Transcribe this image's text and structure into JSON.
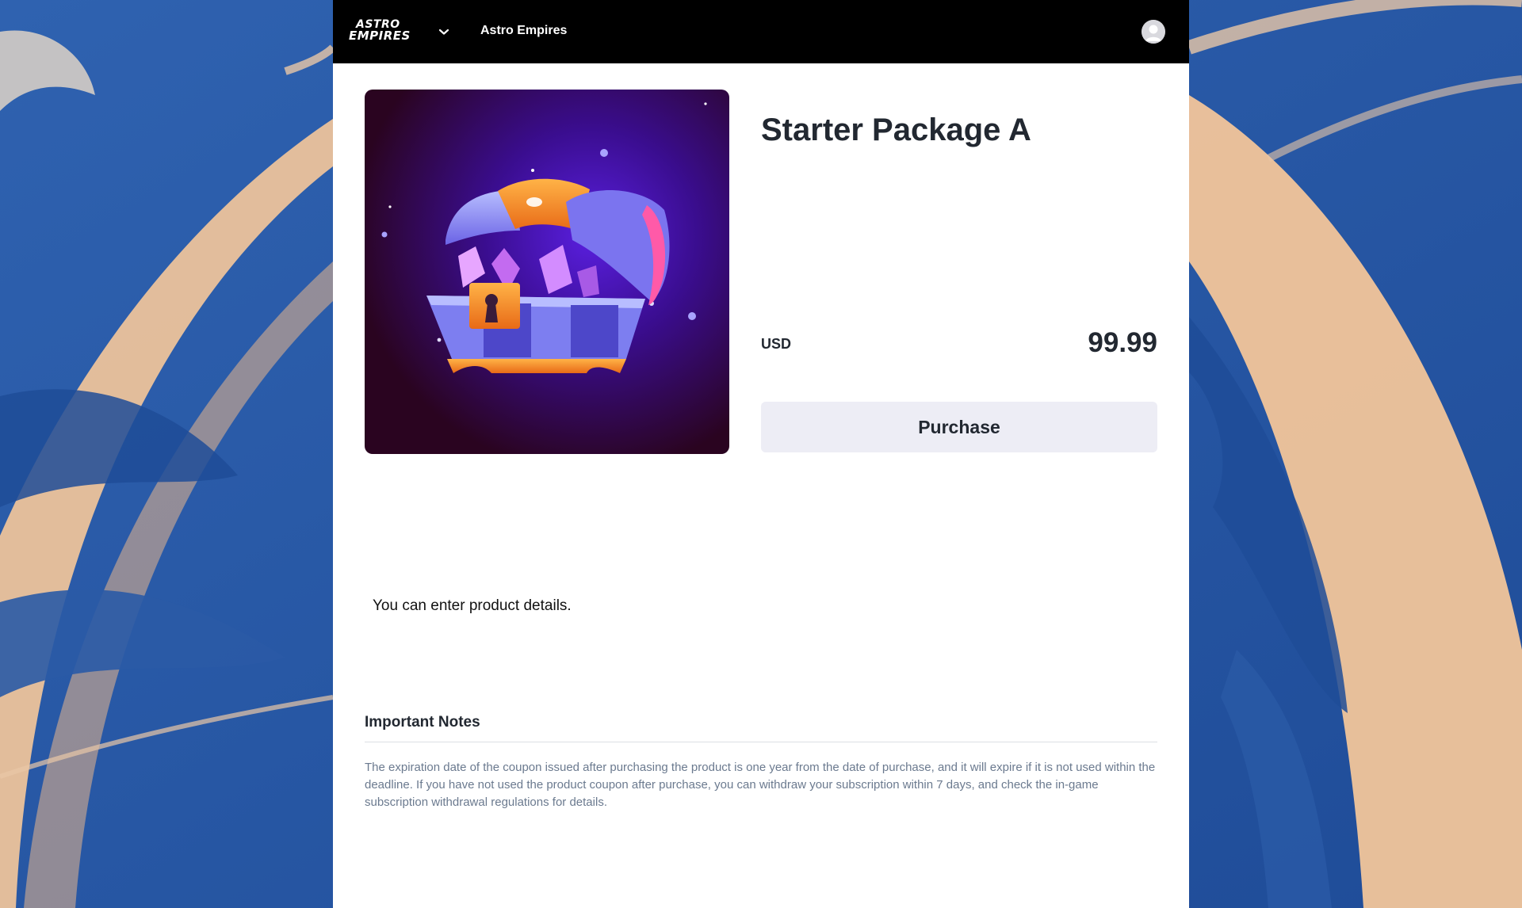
{
  "header": {
    "logo_line1": "Astro",
    "logo_line2": "Empires",
    "game_name": "Astro Empires",
    "icons": {
      "dropdown": "chevron-down-icon",
      "account": "avatar"
    }
  },
  "product": {
    "title": "Starter Package A",
    "currency": "USD",
    "price": "99.99",
    "purchase_label": "Purchase",
    "details": "You can enter product details.",
    "image_subject": "treasure-chest-icon"
  },
  "notes": {
    "heading": "Important Notes",
    "body": "The expiration date of the coupon issued after purchasing the product is one year from the date of purchase, and it will expire if it is not used within the deadline. If you have not used the product coupon after purchase, you can withdraw your subscription within 7 days, and check the in-game subscription withdrawal regulations for details."
  },
  "colors": {
    "topbar": "#000000",
    "panel": "#ffffff",
    "background": "#2a5aa6",
    "button": "#ededf5",
    "notes_text": "#6b7a8f"
  }
}
